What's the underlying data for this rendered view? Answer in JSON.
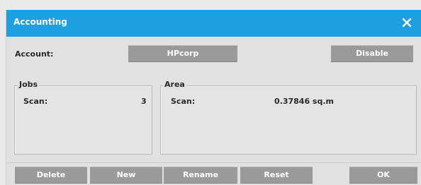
{
  "dialog": {
    "title": "Accounting",
    "close_icon": "close-icon"
  },
  "account": {
    "label": "Account:",
    "selected": "HPcorp",
    "disable_label": "Disable"
  },
  "jobs": {
    "title": "Jobs",
    "scan_label": "Scan:",
    "scan_value": "3"
  },
  "area": {
    "title": "Area",
    "scan_label": "Scan:",
    "scan_value": "0.37846 sq.m"
  },
  "footer": {
    "delete_label": "Delete",
    "new_label": "New",
    "rename_label": "Rename",
    "reset_label": "Reset",
    "ok_label": "OK"
  },
  "colors": {
    "titlebar": "#1e9fe0",
    "button": "#9a9a9a",
    "background": "#e1e1e1"
  }
}
